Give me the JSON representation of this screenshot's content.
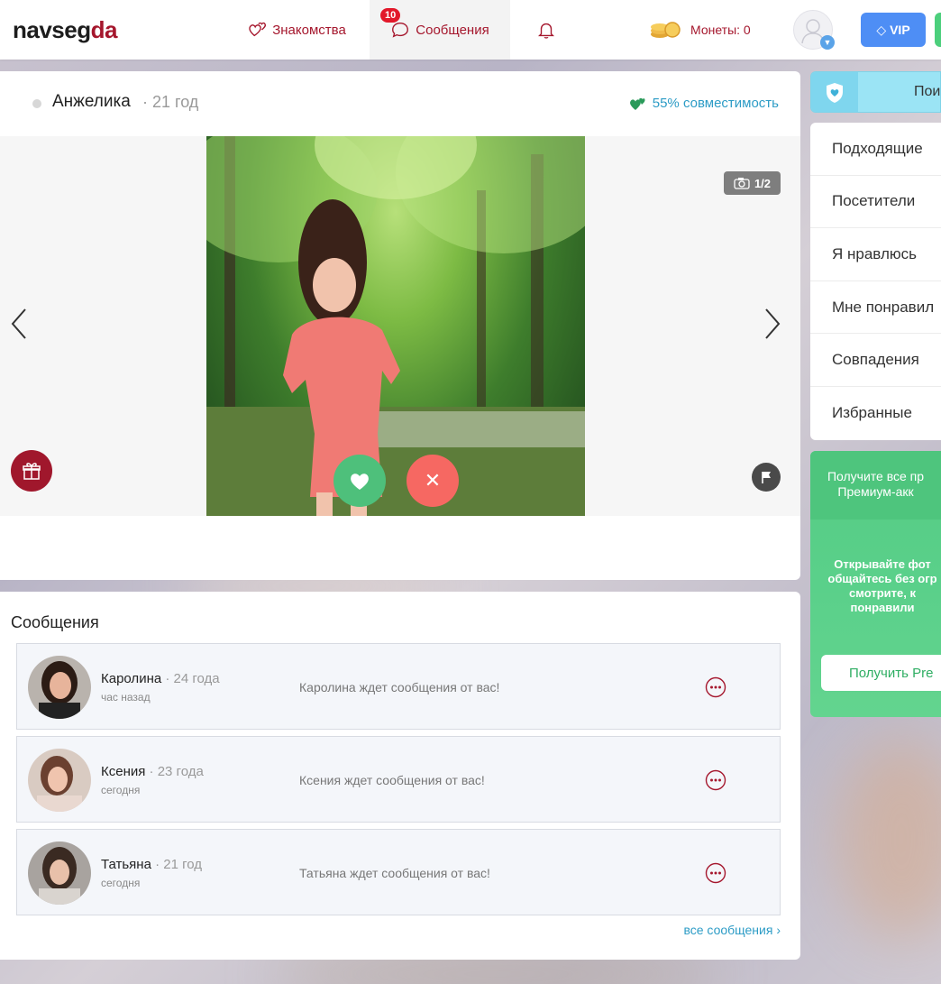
{
  "header": {
    "logo_main": "navseg",
    "logo_accent": "da",
    "nav": {
      "dating": "Знакомства",
      "messages": "Сообщения",
      "messages_badge": "10"
    },
    "coins_label": "Монеты: 0",
    "vip_label": "VIP"
  },
  "profile": {
    "name": "Анжелика",
    "age": "· 21 год",
    "compatibility": "55% совместимость",
    "photo_counter": "1/2"
  },
  "messages": {
    "title": "Сообщения",
    "items": [
      {
        "name": "Каролина",
        "age": "· 24 года",
        "time": "час назад",
        "text": "Каролина ждет сообщения от вас!"
      },
      {
        "name": "Ксения",
        "age": "· 23 года",
        "time": "сегодня",
        "text": "Ксения ждет сообщения от вас!"
      },
      {
        "name": "Татьяна",
        "age": "· 21 год",
        "time": "сегодня",
        "text": "Татьяна ждет сообщения от вас!"
      }
    ],
    "all_link": "все сообщения ›"
  },
  "sidebar": {
    "search_label": "Пои",
    "menu": [
      "Подходящие",
      "Посетители",
      "Я нравлюсь",
      "Мне понравил",
      "Совпадения",
      "Избранные"
    ],
    "promo": {
      "line1": "Получите все пр",
      "line2": "Премиум-акк",
      "body1": "Открывайте фот",
      "body2": "общайтесь без огр",
      "body3": "смотрите, к",
      "body4": "понравили",
      "button": "Получить Pre"
    }
  },
  "colors": {
    "brand": "#a5172d",
    "link": "#2d9cc6",
    "like": "#4ec07b",
    "dislike": "#f66862",
    "vip": "#4e8ef5",
    "promo": "#55cc84"
  }
}
